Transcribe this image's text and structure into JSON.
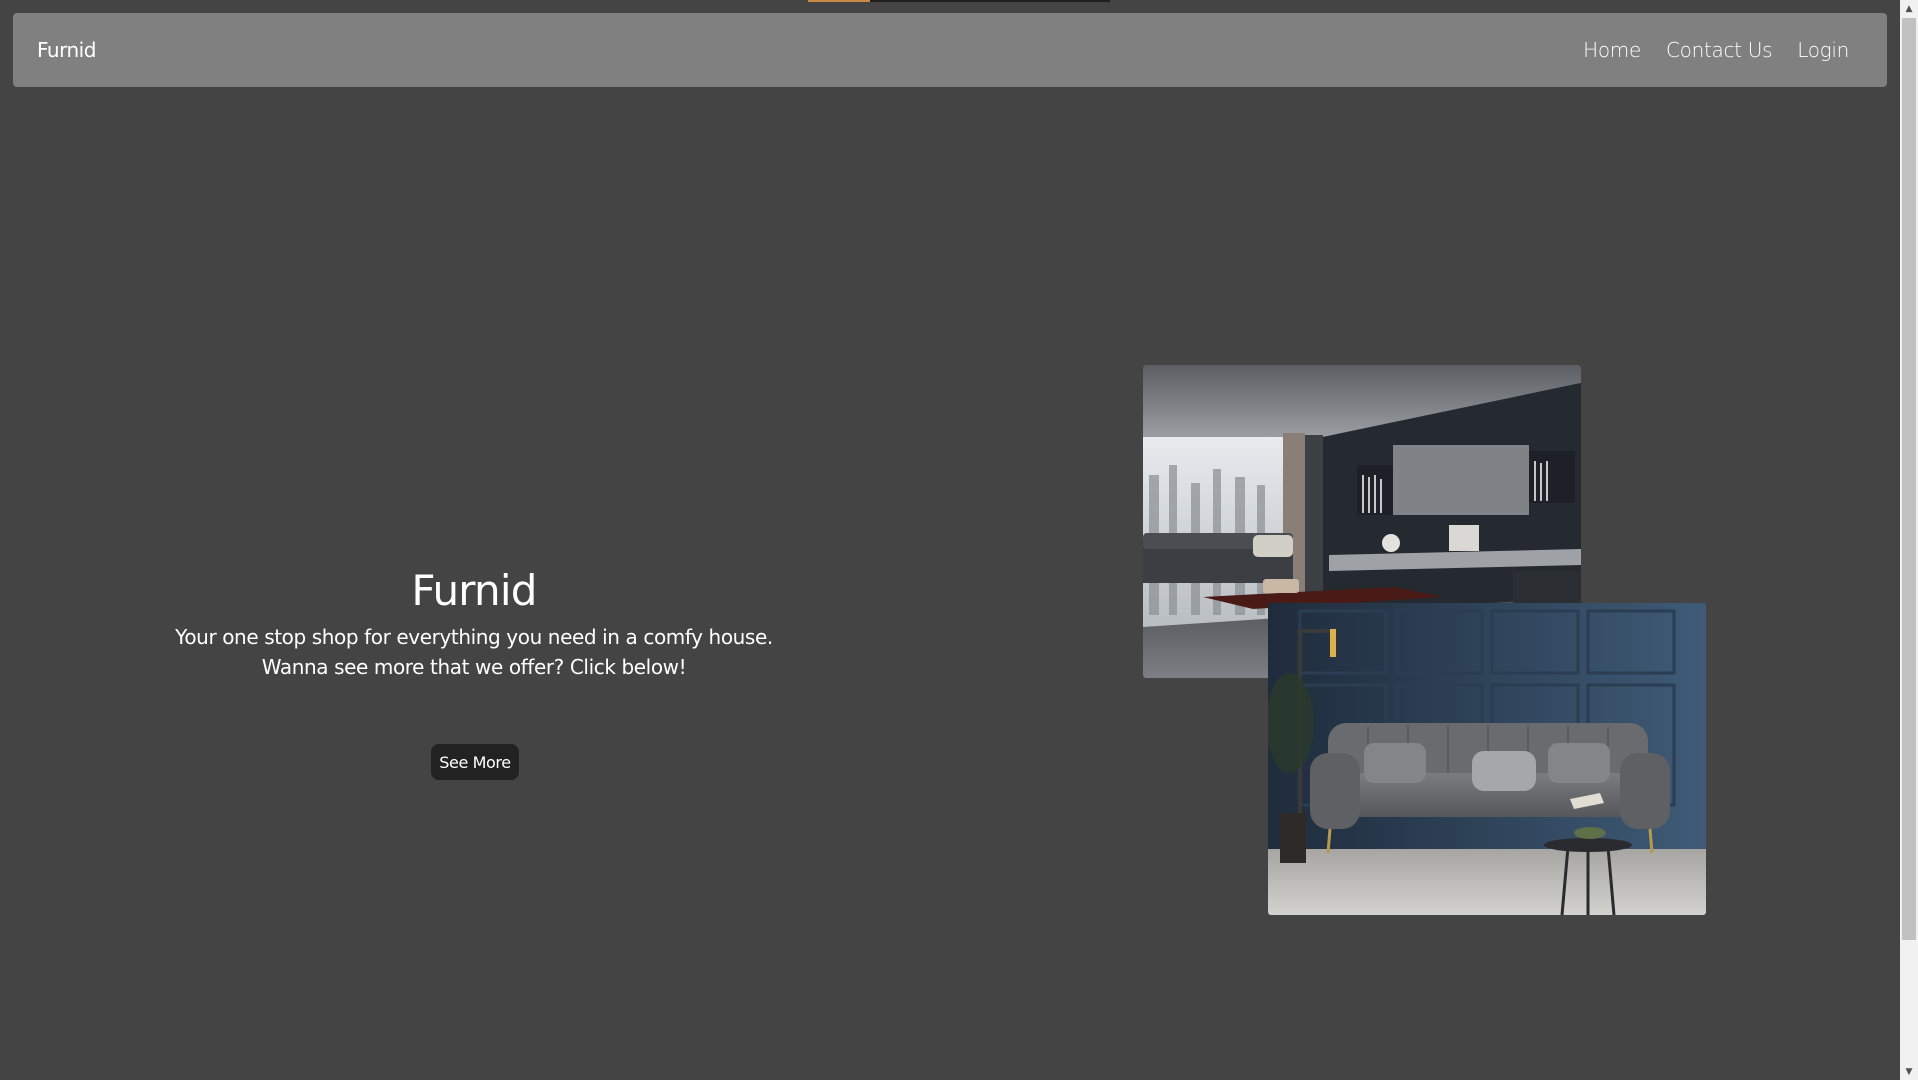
{
  "nav": {
    "brand": "Furnid",
    "links": [
      "Home",
      "Contact Us",
      "Login"
    ]
  },
  "hero": {
    "title": "Furnid",
    "subtitle_line1": "Your one stop shop for everything you need in a comfy house.",
    "subtitle_line2": "Wanna see more that we offer? Click below!",
    "button_label": "See More"
  },
  "colors": {
    "page_background": "#444444",
    "navbar": "#808080",
    "button": "#222222",
    "text": "#ffffff"
  },
  "icons": {
    "scroll_up": "triangle-up-icon",
    "scroll_down": "triangle-down-icon"
  }
}
